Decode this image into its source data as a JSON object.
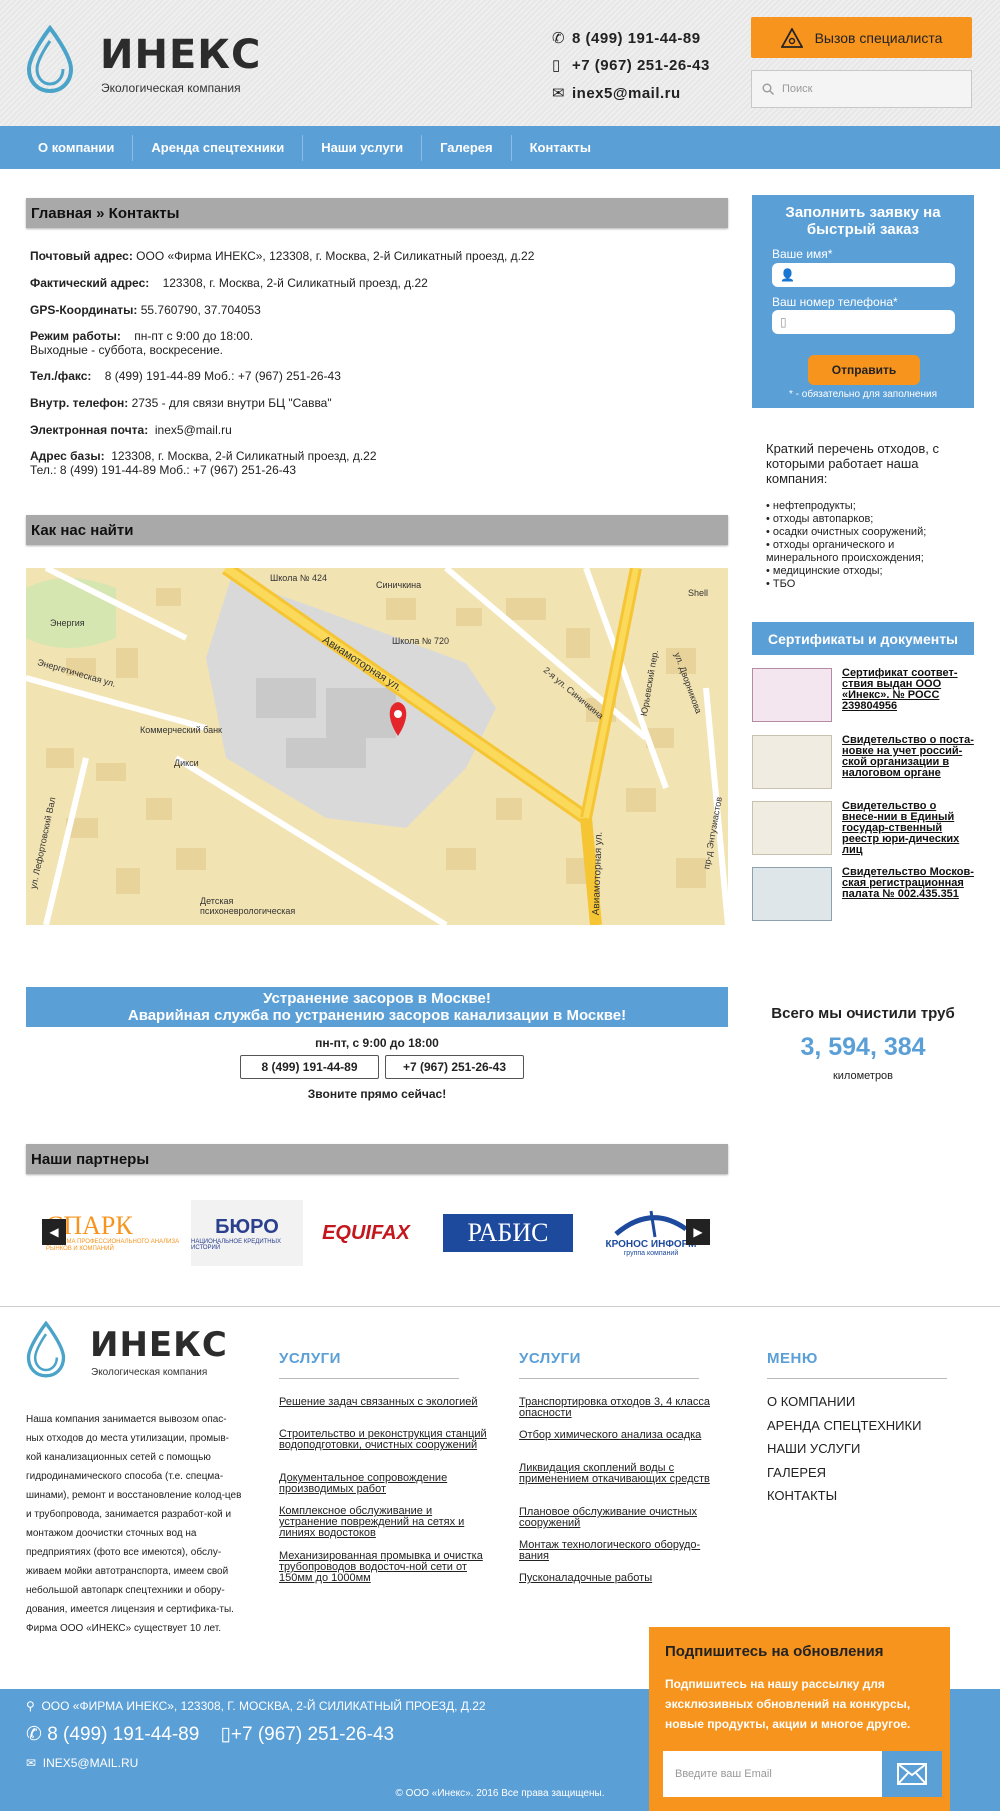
{
  "header": {
    "logo_name": "ИНЕКС",
    "logo_sub": "Экологическая компания",
    "phone1": "8 (499) 191-44-89",
    "phone2": "+7 (967) 251-26-43",
    "email": "inex5@mail.ru",
    "cta_label": "Вызов специалиста",
    "search_placeholder": "Поиск"
  },
  "nav": {
    "items": [
      {
        "label": "О компании"
      },
      {
        "label": "Аренда спецтехники"
      },
      {
        "label": "Наши услуги"
      },
      {
        "label": "Галерея"
      },
      {
        "label": "Контакты"
      }
    ]
  },
  "breadcrumb": "Главная » Контакты",
  "contacts": {
    "postal_label": "Почтовый адрес:",
    "postal_value": "ООО «Фирма ИНЕКС», 123308, г. Москва, 2-й Силикатный проезд, д.22",
    "actual_label": "Фактический адрес:",
    "actual_value": "123308, г. Москва, 2-й Силикатный проезд, д.22",
    "gps_label": "GPS-Координаты:",
    "gps_value": "55.760790, 37.704053",
    "hours_label": "Режим работы:",
    "hours_value": "пн-пт с 9:00 до 18:00.",
    "hours_weekend": "Выходные - суббота, воскресение.",
    "tel_label": "Тел./факс:",
    "tel_value": "8 (499) 191-44-89  Моб.: +7 (967) 251-26-43",
    "inner_label": "Внутр. телефон:",
    "inner_value": "2735 - для связи внутри БЦ \"Савва\"",
    "mail_label": "Электронная почта:",
    "mail_value": "inex5@mail.ru",
    "base_label": "Адрес базы:",
    "base_value": "123308, г. Москва, 2-й Силикатный проезд, д.22",
    "base_tel": "Тел.: 8 (499) 191-44-89  Моб.: +7 (967) 251-26-43"
  },
  "find_us": "Как нас найти",
  "map": {
    "labels": [
      "Школа № 424",
      "Синичкина",
      "Энергия",
      "Школа № 720",
      "Shell",
      "Коммерческий банк",
      "Дикси",
      "Авиамоторная ул.",
      "Энергетическая ул.",
      "2-я ул. Синичкина",
      "Юрьевский пер.",
      "ул. Дворникова",
      "Детская психоневрологическая",
      "ул. Лефортовский Вал",
      "пр-д Энтузиастов",
      "Авиамоторная ул."
    ]
  },
  "order": {
    "title": "Заполнить заявку на быстрый заказ",
    "name_label": "Ваше имя*",
    "phone_label": "Ваш номер телефона*",
    "submit": "Отправить",
    "note": "* - обязательно для заполнения"
  },
  "waste": {
    "intro": "Краткий перечень отходов, с которыми работает наша компания:",
    "items": [
      "• нефтепродукты;",
      "• отходы автопарков;",
      "• осадки очистных сооружений;",
      "• отходы органического и",
      "минерального происхождения;",
      "• медицинские отходы;",
      "• ТБО"
    ]
  },
  "certs": {
    "title": "Сертификаты и документы",
    "items": [
      {
        "text": "Сертификат соответ-ствия выдан ООО «Инекс». № РОСС 239804956"
      },
      {
        "text": "Свидетельство о поста-новке на учет россий-ской организации в налоговом органе"
      },
      {
        "text": "Свидетельство о внесе-нии в Единый государ-ственный реестр юри-дических лиц"
      },
      {
        "text": "Свидетельство Москов-ская регистрационная палата № 002.435.351"
      }
    ]
  },
  "emergency": {
    "line1": "Устранение засоров в Москве!",
    "line2": "Аварийная служба по устранению засоров канализации в Москве!",
    "hours": "пн-пт, с 9:00 до 18:00",
    "phone1": "8 (499) 191-44-89",
    "phone2": "+7 (967) 251-26-43",
    "call": "Звоните прямо сейчас!"
  },
  "counter": {
    "title": "Всего мы очистили труб",
    "value": "3, 594, 384",
    "unit": "километров"
  },
  "partners": {
    "title": "Наши партнеры",
    "items": [
      {
        "name": "СПАРК",
        "sub": "СИСТЕМА ПРОФЕССИОНАЛЬНОГО АНАЛИЗА РЫНКОВ И КОМПАНИЙ"
      },
      {
        "name": "БЮРО",
        "sub": "НАЦИОНАЛЬНОЕ КРЕДИТНЫХ ИСТОРИЙ"
      },
      {
        "name": "EQUIFAX"
      },
      {
        "name": "РАБИС"
      },
      {
        "name": "КРОНОС ИНФОРМ",
        "sub": "группа компаний"
      }
    ]
  },
  "footer": {
    "logo_name": "ИНЕКС",
    "logo_sub": "Экологическая компания",
    "about": "Наша компания занимается вывозом опас-ных отходов до места утилизации, промыв-кой канализационных сетей с помощью гидродинамического способа (т.е. спецма-шинами), ремонт и восстановление колод-цев и трубопровода, занимается разработ-кой и монтажом доочистки сточных вод на предприятиях (фото все имеются), обслу-живаем мойки автотранспорта, имеем свой небольшой автопарк спецтехники и обору-дования, имеется лицензия и сертифика-ты.",
    "about_years": "Фирма ООО «ИНЕКС» существует 10 лет.",
    "col1_title": "УСЛУГИ",
    "col1_links": [
      "Решение задач связанных с экологией",
      "Строительство и реконструкция станций водоподготовки, очистных сооружений",
      "Документальное сопровождение производимых работ",
      "Комплексное обслуживание и устранение повреждений на сетях и линиях водостоков",
      "Механизированная промывка и очистка трубопроводов водосточ-ной сети от 150мм до 1000мм"
    ],
    "col2_title": "УСЛУГИ",
    "col2_links": [
      "Транспортировка отходов 3, 4 класса опасности",
      "Отбор химического анализа осадка",
      "Ликвидация скоплений воды с применением откачивающих средств",
      "Плановое обслуживание очистных сооружений",
      "Монтаж технологического оборудо-вания",
      "Пусконаладочные работы"
    ],
    "menu_title": "МЕНЮ",
    "menu_items": [
      "О КОМПАНИИ",
      "АРЕНДА СПЕЦТЕХНИКИ",
      "НАШИ УСЛУГИ",
      "ГАЛЕРЕЯ",
      "КОНТАКТЫ"
    ],
    "address": "ООО «ФИРМА ИНЕКС», 123308, Г. МОСКВА, 2-Й СИЛИКАТНЫЙ ПРОЕЗД, Д.22",
    "phone1": "8 (499) 191-44-89",
    "phone2": "+7 (967) 251-26-43",
    "email": "INEX5@MAIL.RU",
    "copyright": "© ООО «Инекс». 2016 Все права защищены."
  },
  "subscribe": {
    "title": "Подпишитесь на обновления",
    "text": "Подпишитесь на нашу рассылку для эксклюзивных обновлений на конкурсы, новые продукты, акции и многое другое.",
    "placeholder": "Введите ваш Email"
  },
  "colors": {
    "accent": "#5b9fd7",
    "orange": "#f7941e",
    "bar_gray": "#a9a9a9"
  }
}
